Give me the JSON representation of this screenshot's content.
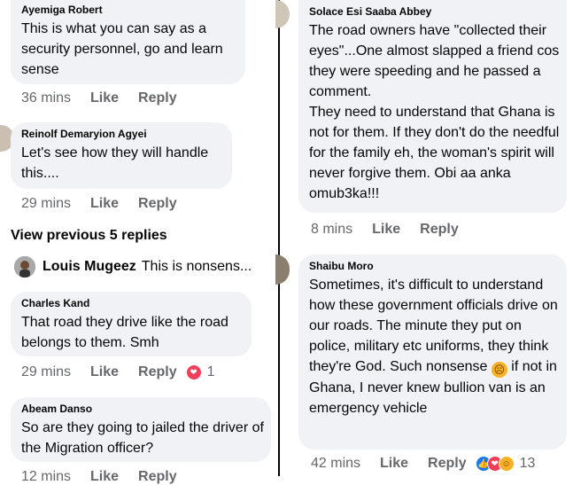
{
  "left": {
    "comments": [
      {
        "name": "Ayemiga Robert",
        "text": "This is what you can say as a security personnel, go and learn sense",
        "time": "36 mins",
        "like": "Like",
        "reply": "Reply"
      },
      {
        "name": "Reinolf Demaryion Agyei",
        "text": "Let's see how they will handle this....",
        "time": "29 mins",
        "like": "Like",
        "reply": "Reply"
      },
      {
        "name": "Charles Kand",
        "text": "That road they drive like the road belongs to them. Smh",
        "time": "29 mins",
        "like": "Like",
        "reply": "Reply",
        "reaction_count": "1"
      },
      {
        "name": "Abeam Danso",
        "text": "So are they going to jailed the driver of the Migration officer?",
        "time": "12 mins",
        "like": "Like",
        "reply": "Reply"
      }
    ],
    "view_previous": "View previous 5 replies",
    "preview_reply": {
      "name": "Louis Mugeez",
      "text": "This is nonsens..."
    }
  },
  "right": {
    "comments": [
      {
        "name": "Solace Esi Saaba Abbey",
        "text": "The road owners have \"collected their eyes\"...One almost slapped a friend cos they were speeding and he passed a comment.\nThey need to understand that Ghana is not for them. If they don't do the needful for the family eh, the woman's spirit will never forgive them. Obi aa anka omub3ka!!!",
        "time": "8 mins",
        "like": "Like",
        "reply": "Reply"
      },
      {
        "name": "Shaibu Moro",
        "text_before": "Sometimes, it's difficult to understand how these government officials drive on our roads. The minute they put on police, military etc uniforms, they think they're God. Such nonsense",
        "text_after": " if not in Ghana, I never knew bullion van is an emergency vehicle",
        "time": "42 mins",
        "like": "Like",
        "reply": "Reply",
        "reaction_count": "13"
      }
    ]
  },
  "colors": {
    "bubble": "#f0f2f5",
    "meta": "#65676b",
    "like_blue": "#1877f2",
    "love_red": "#f33e58",
    "haha_yellow": "#f7b125"
  }
}
